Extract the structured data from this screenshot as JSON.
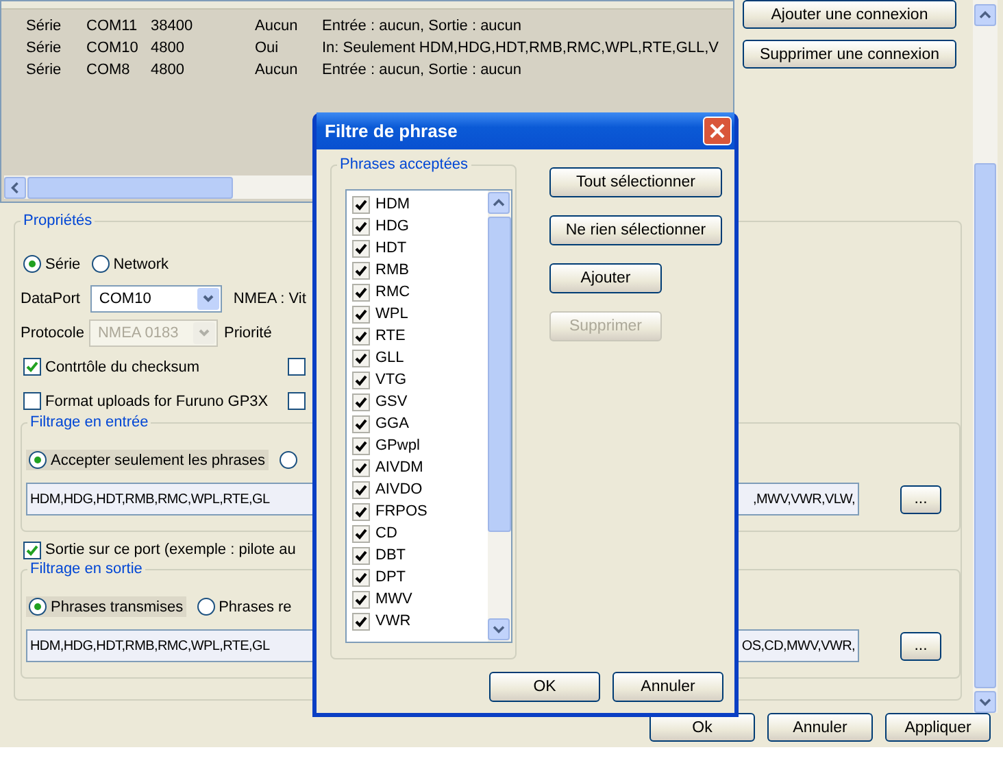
{
  "connections_list": {
    "rows": [
      {
        "type": "Série",
        "port": "COM11",
        "parameters": "38400",
        "output": "Aucun",
        "filters": "Entrée : aucun, Sortie : aucun"
      },
      {
        "type": "Série",
        "port": "COM10",
        "parameters": "4800",
        "output": "Oui",
        "filters": "In: Seulement HDM,HDG,HDT,RMB,RMC,WPL,RTE,GLL,V"
      },
      {
        "type": "Série",
        "port": "COM8",
        "parameters": "4800",
        "output": "Aucun",
        "filters": "Entrée : aucun, Sortie : aucun"
      }
    ]
  },
  "connection_buttons": [
    "Ajouter une connexion",
    "Supprimer une connexion"
  ],
  "properties": {
    "title": "Propriétés",
    "interface_options": [
      {
        "label": "Série",
        "selected": true
      },
      {
        "label": "Network",
        "selected": false
      }
    ],
    "dataport": {
      "label": "DataPort",
      "value": "COM10"
    },
    "nmea_speed_label": "NMEA : Vit",
    "protocol": {
      "label": "Protocole",
      "value": "NMEA 0183",
      "disabled": true
    },
    "priority_label": "Priorité",
    "options": [
      {
        "label": "Contrtôle du checksum",
        "checked": true,
        "side_checked": false
      },
      {
        "label": "Format uploads for Furuno GP3X",
        "checked": false,
        "side_checked": false
      }
    ],
    "input_filter": {
      "title": "Filtrage en entrée",
      "modes": [
        {
          "label": "Accepter seulement les phrases",
          "selected": true
        },
        {
          "selected": false
        }
      ],
      "value_start": "HDM,HDG,HDT,RMB,RMC,WPL,RTE,GL",
      "value_end": ",MWV,VWR,VLW,",
      "browse_button": "..."
    },
    "output_enabled": {
      "label": "Sortie sur ce port (exemple : pilote au",
      "checked": true
    },
    "output_filter": {
      "title": "Filtrage en sortie",
      "modes": [
        {
          "label": "Phrases transmises",
          "selected": true
        },
        {
          "label": "Phrases re",
          "selected": false
        }
      ],
      "value_start": "HDM,HDG,HDT,RMB,RMC,WPL,RTE,GL",
      "value_end": "OS,CD,MWV,VWR,",
      "browse_button": "..."
    }
  },
  "window_buttons": [
    "Ok",
    "Annuler",
    "Appliquer"
  ],
  "sentence_filter_dialog": {
    "title": "Filtre de phrase",
    "group_title": "Phrases acceptées",
    "sentences": [
      {
        "label": "HDM",
        "checked": true
      },
      {
        "label": "HDG",
        "checked": true
      },
      {
        "label": "HDT",
        "checked": true
      },
      {
        "label": "RMB",
        "checked": true
      },
      {
        "label": "RMC",
        "checked": true
      },
      {
        "label": "WPL",
        "checked": true
      },
      {
        "label": "RTE",
        "checked": true
      },
      {
        "label": "GLL",
        "checked": true
      },
      {
        "label": "VTG",
        "checked": true
      },
      {
        "label": "GSV",
        "checked": true
      },
      {
        "label": "GGA",
        "checked": true
      },
      {
        "label": "GPwpl",
        "checked": true
      },
      {
        "label": "AIVDM",
        "checked": true
      },
      {
        "label": "AIVDO",
        "checked": true
      },
      {
        "label": "FRPOS",
        "checked": true
      },
      {
        "label": "CD",
        "checked": true
      },
      {
        "label": "DBT",
        "checked": true
      },
      {
        "label": "DPT",
        "checked": true
      },
      {
        "label": "MWV",
        "checked": true
      },
      {
        "label": "VWR",
        "checked": true
      }
    ],
    "buttons": [
      {
        "label": "Tout sélectionner",
        "disabled": false
      },
      {
        "label": "Ne rien sélectionner",
        "disabled": false
      },
      {
        "label": "Ajouter",
        "disabled": false
      },
      {
        "label": "Supprimer",
        "disabled": true
      }
    ],
    "footer_buttons": [
      "OK",
      "Annuler"
    ]
  }
}
